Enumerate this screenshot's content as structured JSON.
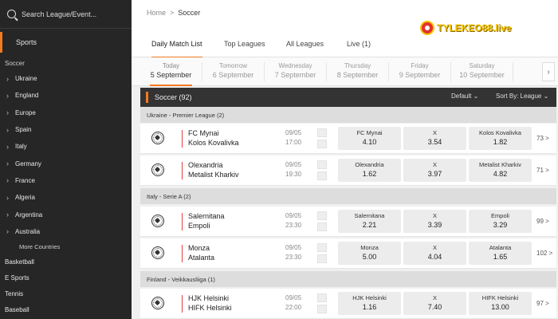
{
  "search": {
    "placeholder": "Search League/Event..."
  },
  "sidebar": {
    "title": "Sports",
    "section": "Soccer",
    "items": [
      {
        "label": "Ukraine"
      },
      {
        "label": "England"
      },
      {
        "label": "Europe"
      },
      {
        "label": "Spain"
      },
      {
        "label": "Italy"
      },
      {
        "label": "Germany"
      },
      {
        "label": "France"
      },
      {
        "label": "Algeria"
      },
      {
        "label": "Argentina"
      },
      {
        "label": "Australia"
      }
    ],
    "more": "More Countries",
    "sports": [
      "Basketball",
      "E Sports",
      "Tennis",
      "Baseball"
    ]
  },
  "breadcrumb": {
    "home": "Home",
    "sep": ">",
    "current": "Soccer"
  },
  "logo": {
    "text": "TYLEKEO88.live"
  },
  "tabs": [
    "Daily Match List",
    "Top Leagues",
    "All Leagues",
    "Live (1)"
  ],
  "dates": [
    {
      "day": "Today",
      "date": "5 September"
    },
    {
      "day": "Tomorrow",
      "date": "6 September"
    },
    {
      "day": "Wednesday",
      "date": "7 September"
    },
    {
      "day": "Thursday",
      "date": "8 September"
    },
    {
      "day": "Friday",
      "date": "9 September"
    },
    {
      "day": "Saturday",
      "date": "10 September"
    }
  ],
  "main": {
    "title": "Soccer (92)",
    "default_label": "Default",
    "sort_label": "Sort By: League"
  },
  "leagues": [
    {
      "name": "Ukraine - Premier League (2)"
    },
    {
      "name": "Italy - Serie A (2)"
    },
    {
      "name": "Finland - Veikkausliiga (1)"
    }
  ],
  "matches": [
    {
      "home": "FC Mynai",
      "away": "Kolos Kovalivka",
      "date": "09/05",
      "time": "17:00",
      "odds": [
        {
          "n": "FC Mynai",
          "v": "4.10"
        },
        {
          "n": "X",
          "v": "3.54"
        },
        {
          "n": "Kolos Kovalivka",
          "v": "1.82"
        }
      ],
      "more": "73 >"
    },
    {
      "home": "Olexandria",
      "away": "Metalist Kharkiv",
      "date": "09/05",
      "time": "19:30",
      "odds": [
        {
          "n": "Olexandria",
          "v": "1.62"
        },
        {
          "n": "X",
          "v": "3.97"
        },
        {
          "n": "Metalist Kharkiv",
          "v": "4.82"
        }
      ],
      "more": "71 >"
    },
    {
      "home": "Salernitana",
      "away": "Empoli",
      "date": "09/05",
      "time": "23:30",
      "odds": [
        {
          "n": "Salernitana",
          "v": "2.21"
        },
        {
          "n": "X",
          "v": "3.39"
        },
        {
          "n": "Empoli",
          "v": "3.29"
        }
      ],
      "more": "99 >"
    },
    {
      "home": "Monza",
      "away": "Atalanta",
      "date": "09/05",
      "time": "23:30",
      "odds": [
        {
          "n": "Monza",
          "v": "5.00"
        },
        {
          "n": "X",
          "v": "4.04"
        },
        {
          "n": "Atalanta",
          "v": "1.65"
        }
      ],
      "more": "102 >"
    },
    {
      "home": "HJK Helsinki",
      "away": "HIFK Helsinki",
      "date": "09/05",
      "time": "22:00",
      "odds": [
        {
          "n": "HJK Helsinki",
          "v": "1.16"
        },
        {
          "n": "X",
          "v": "7.40"
        },
        {
          "n": "HIFK Helsinki",
          "v": "13.00"
        }
      ],
      "more": "97 >"
    }
  ],
  "colors": {
    "accent": "#f47a20",
    "sidebar_bg": "#262626",
    "header_bg": "#333333"
  },
  "icons": {
    "search": "search-icon",
    "ball": "soccer-ball-icon",
    "chevron": "chevron-right-icon"
  }
}
